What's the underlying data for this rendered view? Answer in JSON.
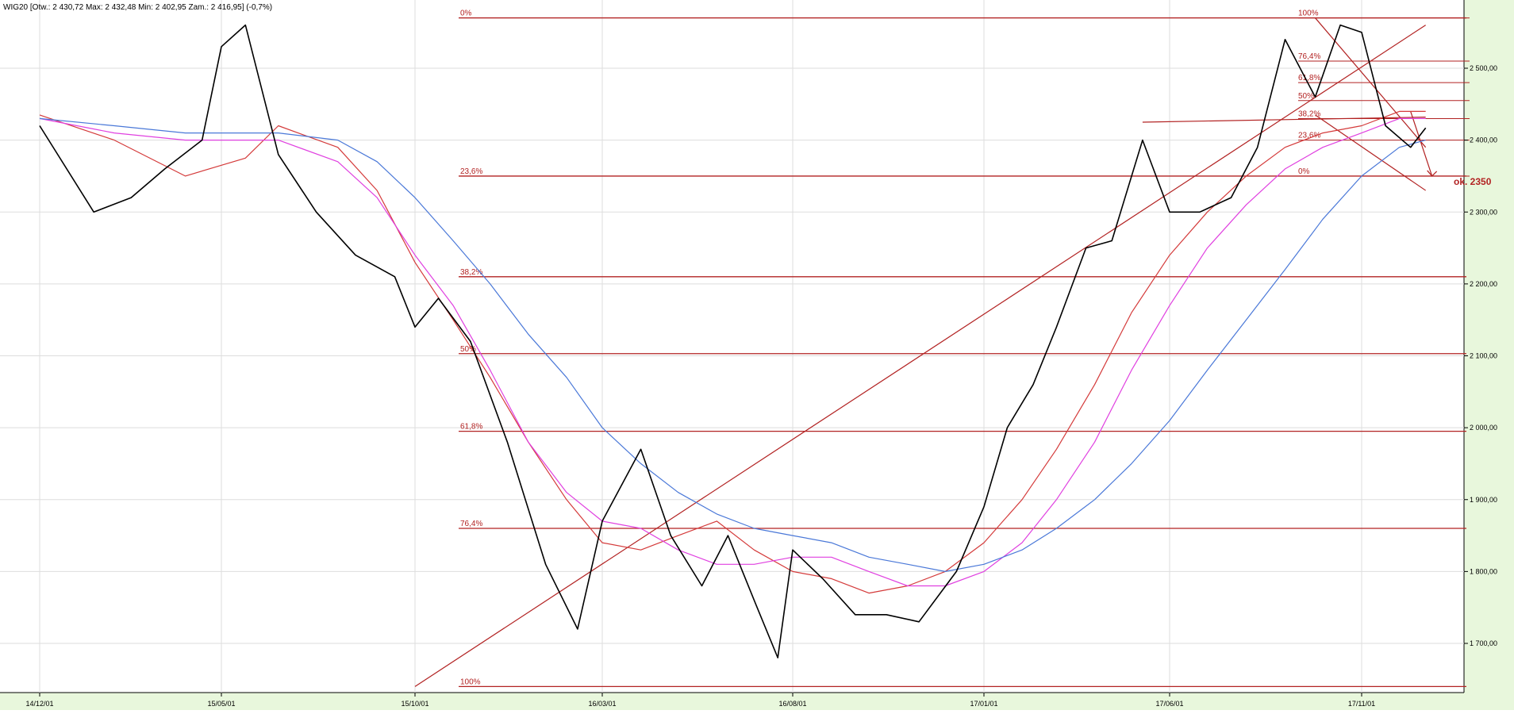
{
  "chart_data": {
    "type": "line",
    "title": "WIG20 [Otw.: 2 430,72  Max: 2 432,48  Min: 2 402,95  Zam.: 2 416,95] (-0,7%)",
    "xlabel": "",
    "ylabel": "",
    "ylim": [
      1640,
      2600
    ],
    "x_ticks": [
      "14/12/01",
      "15/05/01",
      "15/10/01",
      "16/03/01",
      "16/08/01",
      "17/01/01",
      "17/06/01",
      "17/11/01"
    ],
    "y_ticks": [
      "1 700,00",
      "1 800,00",
      "1 900,00",
      "2 000,00",
      "2 100,00",
      "2 200,00",
      "2 300,00",
      "2 400,00",
      "2 500,00"
    ],
    "grid": true,
    "colors": {
      "price": "#000000",
      "fib": "#b22222",
      "ma_red": "#d43a3a",
      "ma_magenta": "#e040e0",
      "ma_blue": "#4a78d8",
      "frame_bg": "#e8f7dc"
    },
    "series": [
      {
        "kind": "price",
        "x": [
          "14/12/01",
          "15/01/15",
          "15/02/15",
          "15/03/15",
          "15/04/15",
          "15/05/01",
          "15/05/20",
          "15/06/15",
          "15/07/15",
          "15/08/15",
          "15/09/15",
          "15/10/01",
          "15/10/20",
          "15/11/15",
          "15/12/15",
          "16/01/15",
          "16/02/10",
          "16/03/01",
          "16/04/01",
          "16/04/25",
          "16/05/20",
          "16/06/10",
          "16/07/01",
          "16/07/20",
          "16/08/01",
          "16/08/25",
          "16/09/20",
          "16/10/15",
          "16/11/10",
          "16/12/10",
          "17/01/01",
          "17/01/20",
          "17/02/10",
          "17/03/01",
          "17/03/25",
          "17/04/15",
          "17/05/10",
          "17/06/01",
          "17/06/25",
          "17/07/20",
          "17/08/10",
          "17/09/01",
          "17/09/25",
          "17/10/15",
          "17/11/01",
          "17/11/20",
          "17/12/10",
          "17/12/22"
        ],
        "values": [
          2420,
          2300,
          2320,
          2360,
          2400,
          2530,
          2560,
          2380,
          2300,
          2240,
          2210,
          2140,
          2180,
          2120,
          1980,
          1810,
          1720,
          1870,
          1970,
          1850,
          1780,
          1850,
          1760,
          1680,
          1830,
          1790,
          1740,
          1740,
          1730,
          1800,
          1890,
          2000,
          2060,
          2140,
          2250,
          2260,
          2400,
          2300,
          2300,
          2320,
          2390,
          2540,
          2460,
          2560,
          2550,
          2420,
          2390,
          2417
        ]
      },
      {
        "kind": "ma_red",
        "x": [
          "14/12/01",
          "15/02/01",
          "15/04/01",
          "15/05/20",
          "15/06/15",
          "15/08/01",
          "15/09/01",
          "15/10/01",
          "15/11/01",
          "15/12/01",
          "16/01/01",
          "16/02/01",
          "16/03/01",
          "16/04/01",
          "16/05/01",
          "16/06/01",
          "16/07/01",
          "16/08/01",
          "16/09/01",
          "16/10/01",
          "16/11/01",
          "16/12/01",
          "17/01/01",
          "17/02/01",
          "17/03/01",
          "17/04/01",
          "17/05/01",
          "17/06/01",
          "17/07/01",
          "17/08/01",
          "17/09/01",
          "17/10/01",
          "17/11/01",
          "17/12/01",
          "17/12/22"
        ],
        "values": [
          2435,
          2400,
          2350,
          2375,
          2420,
          2390,
          2330,
          2230,
          2150,
          2070,
          1980,
          1900,
          1840,
          1830,
          1850,
          1870,
          1830,
          1800,
          1790,
          1770,
          1780,
          1800,
          1840,
          1900,
          1970,
          2060,
          2160,
          2240,
          2300,
          2350,
          2390,
          2410,
          2420,
          2440,
          2440
        ]
      },
      {
        "kind": "ma_magenta",
        "x": [
          "14/12/01",
          "15/02/01",
          "15/04/01",
          "15/05/20",
          "15/06/15",
          "15/08/01",
          "15/09/01",
          "15/10/01",
          "15/11/01",
          "15/12/01",
          "16/01/01",
          "16/02/01",
          "16/03/01",
          "16/04/01",
          "16/05/01",
          "16/06/01",
          "16/07/01",
          "16/08/01",
          "16/09/01",
          "16/10/01",
          "16/11/01",
          "16/12/01",
          "17/01/01",
          "17/02/01",
          "17/03/01",
          "17/04/01",
          "17/05/01",
          "17/06/01",
          "17/07/01",
          "17/08/01",
          "17/09/01",
          "17/10/01",
          "17/11/01",
          "17/12/01",
          "17/12/22"
        ],
        "values": [
          2430,
          2410,
          2400,
          2400,
          2400,
          2370,
          2320,
          2240,
          2170,
          2080,
          1980,
          1910,
          1870,
          1860,
          1830,
          1810,
          1810,
          1820,
          1820,
          1800,
          1780,
          1780,
          1800,
          1840,
          1900,
          1980,
          2080,
          2170,
          2250,
          2310,
          2360,
          2390,
          2410,
          2430,
          2430
        ]
      },
      {
        "kind": "ma_blue",
        "x": [
          "14/12/01",
          "15/02/01",
          "15/04/01",
          "15/05/20",
          "15/06/15",
          "15/08/01",
          "15/09/01",
          "15/10/01",
          "15/11/01",
          "15/12/01",
          "16/01/01",
          "16/02/01",
          "16/03/01",
          "16/04/01",
          "16/05/01",
          "16/06/01",
          "16/07/01",
          "16/08/01",
          "16/09/01",
          "16/10/01",
          "16/11/01",
          "16/12/01",
          "17/01/01",
          "17/02/01",
          "17/03/01",
          "17/04/01",
          "17/05/01",
          "17/06/01",
          "17/07/01",
          "17/08/01",
          "17/09/01",
          "17/10/01",
          "17/11/01",
          "17/12/01",
          "17/12/22"
        ],
        "values": [
          2430,
          2420,
          2410,
          2410,
          2410,
          2400,
          2370,
          2320,
          2260,
          2200,
          2130,
          2070,
          2000,
          1950,
          1910,
          1880,
          1860,
          1850,
          1840,
          1820,
          1810,
          1800,
          1810,
          1830,
          1860,
          1900,
          1950,
          2010,
          2080,
          2150,
          2220,
          2290,
          2350,
          2390,
          2400
        ]
      }
    ],
    "fib_levels": [
      {
        "label": "0%",
        "value": 2570
      },
      {
        "label": "23,6%",
        "value": 2350
      },
      {
        "label": "38,2%",
        "value": 2210
      },
      {
        "label": "50%",
        "value": 2103
      },
      {
        "label": "61,8%",
        "value": 1995
      },
      {
        "label": "76,4%",
        "value": 1860
      },
      {
        "label": "100%",
        "value": 1640
      }
    ],
    "fib_small": [
      {
        "label": "100%",
        "value": 2570
      },
      {
        "label": "76,4%",
        "value": 2510
      },
      {
        "label": "61,8%",
        "value": 2480
      },
      {
        "label": "50%",
        "value": 2455
      },
      {
        "label": "38,2%",
        "value": 2430
      },
      {
        "label": "23,6%",
        "value": 2400
      },
      {
        "label": "0%",
        "value": 2350
      }
    ],
    "trendlines": [
      {
        "from": [
          "15/10/01",
          1640
        ],
        "to": [
          "17/12/22",
          2560
        ]
      },
      {
        "from": [
          "17/05/10",
          2425
        ],
        "to": [
          "17/12/22",
          2432
        ]
      },
      {
        "from": [
          "17/09/25",
          2570
        ],
        "to": [
          "17/12/22",
          2390
        ]
      },
      {
        "from": [
          "17/09/25",
          2435
        ],
        "to": [
          "17/12/22",
          2330
        ]
      }
    ],
    "annotation": "ok. 2350"
  }
}
